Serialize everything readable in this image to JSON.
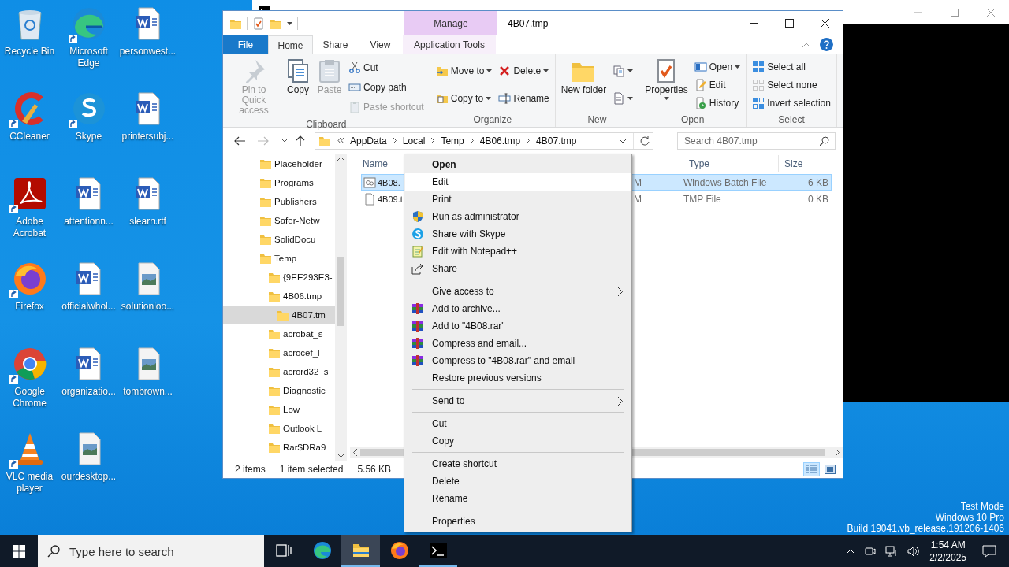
{
  "desktop_icons": [
    {
      "label": "Recycle Bin",
      "kind": "recycle",
      "shortcut": false
    },
    {
      "label": "Microsoft Edge",
      "kind": "edge",
      "shortcut": true
    },
    {
      "label": "personwest...",
      "kind": "word",
      "shortcut": false
    },
    {
      "label": "CCleaner",
      "kind": "ccleaner",
      "shortcut": true
    },
    {
      "label": "Skype",
      "kind": "skype",
      "shortcut": true
    },
    {
      "label": "printersubj...",
      "kind": "word",
      "shortcut": false
    },
    {
      "label": "Adobe Acrobat",
      "kind": "acrobat",
      "shortcut": true
    },
    {
      "label": "attentionn...",
      "kind": "word",
      "shortcut": false
    },
    {
      "label": "slearn.rtf",
      "kind": "word",
      "shortcut": false
    },
    {
      "label": "Firefox",
      "kind": "firefox",
      "shortcut": true
    },
    {
      "label": "officialwhol...",
      "kind": "word",
      "shortcut": false
    },
    {
      "label": "solutionloo...",
      "kind": "image",
      "shortcut": false
    },
    {
      "label": "Google Chrome",
      "kind": "chrome",
      "shortcut": true
    },
    {
      "label": "organizatio...",
      "kind": "word",
      "shortcut": false
    },
    {
      "label": "tombrown...",
      "kind": "image",
      "shortcut": false
    },
    {
      "label": "VLC media player",
      "kind": "vlc",
      "shortcut": true
    },
    {
      "label": "ourdesktop...",
      "kind": "image",
      "shortcut": false
    }
  ],
  "system_notice": [
    "Test Mode",
    "Windows 10 Pro",
    "Build 19041.vb_release.191206-1406"
  ],
  "explorer": {
    "title": "4B07.tmp",
    "contextual_group": "Manage",
    "tabs": [
      {
        "label": "File",
        "kind": "file",
        "selected": false
      },
      {
        "label": "Home",
        "kind": "tab",
        "selected": true
      },
      {
        "label": "Share",
        "kind": "tab",
        "selected": false
      },
      {
        "label": "View",
        "kind": "tab",
        "selected": false
      },
      {
        "label": "Application Tools",
        "kind": "contextual",
        "selected": false
      }
    ],
    "ribbon_groups": [
      {
        "label": "Clipboard",
        "columns": [
          [
            {
              "label": "Pin to Quick access",
              "kind": "pin",
              "disabled": true,
              "dropdown": false
            }
          ],
          [
            {
              "label": "Copy",
              "kind": "copy",
              "disabled": false,
              "dropdown": false
            }
          ],
          [
            {
              "label": "Paste",
              "kind": "paste",
              "disabled": true,
              "dropdown": false
            }
          ],
          [
            {
              "label": "Cut",
              "kind": "cut",
              "disabled": false,
              "dropdown": false
            },
            {
              "label": "Copy path",
              "kind": "copypath",
              "disabled": false,
              "dropdown": false
            },
            {
              "label": "Paste shortcut",
              "kind": "pasteshortcut",
              "disabled": true,
              "dropdown": false
            }
          ]
        ]
      },
      {
        "label": "Organize",
        "columns": [
          [
            {
              "label": "Move to",
              "kind": "moveto",
              "disabled": false,
              "dropdown": true
            },
            {
              "label": "Copy to",
              "kind": "copyto",
              "disabled": false,
              "dropdown": true
            }
          ],
          [
            {
              "label": "Delete",
              "kind": "delete",
              "disabled": false,
              "dropdown": true
            },
            {
              "label": "Rename",
              "kind": "rename",
              "disabled": false,
              "dropdown": false
            }
          ]
        ]
      },
      {
        "label": "New",
        "columns": [
          [
            {
              "label": "New folder",
              "kind": "newfolder",
              "disabled": false,
              "dropdown": false
            }
          ],
          [
            {
              "kind": "newitem",
              "disabled": false,
              "dropdown": true
            },
            {
              "kind": "easyaccess",
              "disabled": false,
              "dropdown": true
            }
          ]
        ]
      },
      {
        "label": "Open",
        "columns": [
          [
            {
              "label": "Properties",
              "kind": "properties",
              "disabled": false,
              "dropdown": true
            }
          ],
          [
            {
              "label": "Open",
              "kind": "open",
              "disabled": false,
              "dropdown": true
            },
            {
              "label": "Edit",
              "kind": "edit",
              "disabled": false,
              "dropdown": false
            },
            {
              "label": "History",
              "kind": "history",
              "disabled": false,
              "dropdown": false
            }
          ]
        ]
      },
      {
        "label": "Select",
        "columns": [
          [
            {
              "label": "Select all",
              "kind": "selectall",
              "disabled": false,
              "dropdown": false
            },
            {
              "label": "Select none",
              "kind": "selectnone",
              "disabled": false,
              "dropdown": false
            },
            {
              "label": "Invert selection",
              "kind": "invert",
              "disabled": false,
              "dropdown": false
            }
          ]
        ]
      }
    ],
    "address": {
      "crumbs": [
        "AppData",
        "Local",
        "Temp",
        "4B06.tmp",
        "4B07.tmp"
      ],
      "search_placeholder": "Search 4B07.tmp"
    },
    "nav_tree": [
      {
        "label": "Placeholder",
        "selected": false
      },
      {
        "label": "Programs",
        "selected": false
      },
      {
        "label": "Publishers",
        "selected": false
      },
      {
        "label": "Safer-Netw",
        "selected": false
      },
      {
        "label": "SolidDocu",
        "selected": false
      },
      {
        "label": "Temp",
        "selected": false,
        "children": [
          {
            "label": "{9EE293E3-",
            "selected": false
          },
          {
            "label": "4B06.tmp",
            "selected": false,
            "children": [
              {
                "label": "4B07.tm",
                "selected": true
              }
            ]
          },
          {
            "label": "acrobat_s",
            "selected": false
          },
          {
            "label": "acrocef_l",
            "selected": false
          },
          {
            "label": "acrord32_s",
            "selected": false
          },
          {
            "label": "Diagnostic",
            "selected": false
          },
          {
            "label": "Low",
            "selected": false
          },
          {
            "label": "Outlook L",
            "selected": false
          },
          {
            "label": "Rar$DRa9",
            "selected": false
          }
        ]
      }
    ],
    "columns": [
      "Name",
      "Type",
      "Size"
    ],
    "files": [
      {
        "name": "4B08.",
        "kind": "batch",
        "column_2": "M",
        "type": "Windows Batch File",
        "size": "6 KB",
        "selected": true
      },
      {
        "name": "4B09.t",
        "kind": "file",
        "column_2": "M",
        "type": "TMP File",
        "size": "0 KB",
        "selected": false
      }
    ],
    "status": {
      "count": "2 items",
      "selection": "1 item selected",
      "size": "5.56 KB"
    },
    "view_buttons": [
      {
        "kind": "details",
        "selected": true
      },
      {
        "kind": "large",
        "selected": false
      }
    ]
  },
  "context_menu": [
    {
      "kind": "item",
      "label": "Open",
      "default": true,
      "selected": false
    },
    {
      "kind": "item",
      "label": "Edit",
      "default": false,
      "selected": true
    },
    {
      "kind": "item",
      "label": "Print",
      "default": false,
      "selected": false
    },
    {
      "kind": "shield",
      "label": "Run as administrator",
      "default": false,
      "selected": false
    },
    {
      "kind": "skype",
      "label": "Share with Skype",
      "default": false,
      "selected": false
    },
    {
      "kind": "notepad",
      "label": "Edit with Notepad++",
      "default": false,
      "selected": false
    },
    {
      "kind": "share",
      "label": "Share",
      "default": false,
      "selected": false
    },
    {
      "kind": "separator"
    },
    {
      "kind": "submenu",
      "label": "Give access to",
      "default": false,
      "selected": false
    },
    {
      "kind": "archive",
      "label": "Add to archive...",
      "default": false,
      "selected": false
    },
    {
      "kind": "archive",
      "label": "Add to \"4B08.rar\"",
      "default": false,
      "selected": false
    },
    {
      "kind": "archive",
      "label": "Compress and email...",
      "default": false,
      "selected": false
    },
    {
      "kind": "archive",
      "label": "Compress to \"4B08.rar\" and email",
      "default": false,
      "selected": false
    },
    {
      "kind": "item",
      "label": "Restore previous versions",
      "default": false,
      "selected": false
    },
    {
      "kind": "separator"
    },
    {
      "kind": "submenu",
      "label": "Send to",
      "default": false,
      "selected": false
    },
    {
      "kind": "separator"
    },
    {
      "kind": "item",
      "label": "Cut",
      "default": false,
      "selected": false
    },
    {
      "kind": "item",
      "label": "Copy",
      "default": false,
      "selected": false
    },
    {
      "kind": "separator"
    },
    {
      "kind": "item",
      "label": "Create shortcut",
      "default": false,
      "selected": false
    },
    {
      "kind": "item",
      "label": "Delete",
      "default": false,
      "selected": false
    },
    {
      "kind": "item",
      "label": "Rename",
      "default": false,
      "selected": false
    },
    {
      "kind": "separator"
    },
    {
      "kind": "item",
      "label": "Properties",
      "default": false,
      "selected": false
    }
  ],
  "taskbar": {
    "search_placeholder": "Type here to search",
    "apps": [
      {
        "kind": "taskview",
        "open": false,
        "selected": false
      },
      {
        "kind": "edge",
        "open": false,
        "selected": false
      },
      {
        "kind": "explorer",
        "open": true,
        "selected": true
      },
      {
        "kind": "firefox",
        "open": false,
        "selected": false
      },
      {
        "kind": "terminal",
        "open": true,
        "selected": false
      }
    ],
    "time": "1:54 AM",
    "date": "2/2/2025"
  }
}
